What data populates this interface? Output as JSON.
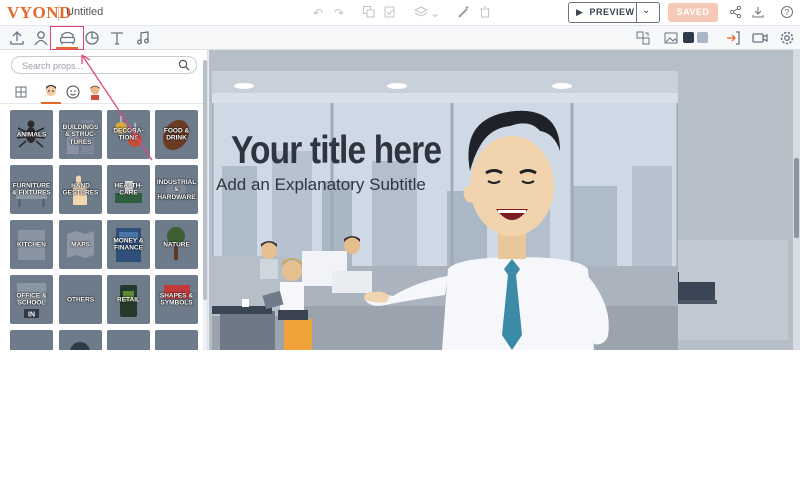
{
  "app": {
    "logo": "VYOND",
    "document_title": "Untitled"
  },
  "topbar": {
    "preview_label": "PREVIEW",
    "saved_label": "SAVED",
    "icons": [
      "undo-icon",
      "redo-icon",
      "copy-icon",
      "paste-icon",
      "layers-icon",
      "chevron-down-icon",
      "magic-wand-icon",
      "trash-icon",
      "share-icon",
      "download-icon",
      "help-icon"
    ]
  },
  "toolbar": {
    "tools": [
      "upload-icon",
      "character-icon",
      "props-icon",
      "chart-icon",
      "text-icon",
      "music-icon"
    ],
    "active_tool": "props-icon",
    "right_icons": [
      "swap-icon",
      "image-icon",
      "enter-icon",
      "video-icon",
      "settings-icon"
    ],
    "swatches": [
      "#2f3a4f",
      "#aab6c8"
    ]
  },
  "props_panel": {
    "search_placeholder": "Search props...",
    "tiles": [
      "ANIMALS",
      "BUILDINGS & STRUC-TURES",
      "DECORA-TIONS",
      "FOOD & DRINK",
      "FURNITURE & FIXTURES",
      "HAND GESTURES",
      "HEALTH-CARE",
      "INDUSTRIAL & HARDWARE",
      "KITCHEN",
      "MAPS",
      "MONEY & FINANCE",
      "NATURE",
      "OFFICE & SCHOOL",
      "OTHERS",
      "RETAIL",
      "SHAPES & SYMBOLS",
      "",
      "",
      "",
      ""
    ]
  },
  "scene": {
    "title": "Your title here",
    "subtitle": "Add an Explanatory Subtitle"
  },
  "colors": {
    "brand": "#e8682a",
    "highlight": "#e0457b"
  }
}
